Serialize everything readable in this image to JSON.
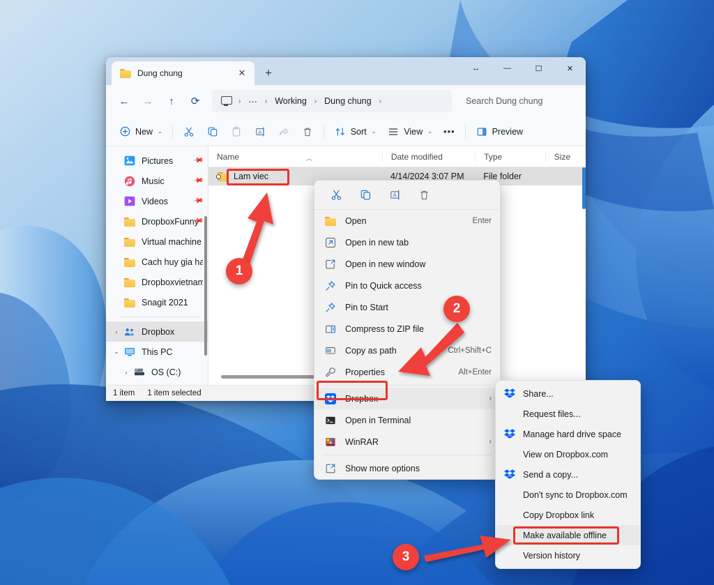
{
  "window": {
    "tab_title": "Dung chung",
    "tab_close_glyph": "✕",
    "newtab_glyph": "+",
    "minimize_glyph": "—",
    "maximize_glyph": "☐",
    "close_glyph": "✕",
    "snap_glyph": "↔"
  },
  "nav": {
    "back_glyph": "←",
    "forward_glyph": "→",
    "up_glyph": "↑",
    "refresh_glyph": "⟳",
    "breadcrumb": [
      "⋯",
      "Working",
      "Dung chung"
    ],
    "separator_glyph": "›"
  },
  "search": {
    "placeholder": "Search Dung chung"
  },
  "toolbar": {
    "new_label": "New",
    "cut_label": "Cut",
    "copy_label": "Copy",
    "paste_label": "Paste",
    "rename_label": "Rename",
    "share_label": "Share",
    "delete_label": "Delete",
    "sort_label": "Sort",
    "view_label": "View",
    "more_glyph": "•••",
    "preview_label": "Preview"
  },
  "sidebar": {
    "items": [
      {
        "label": "Pictures",
        "icon": "pictures-icon",
        "pinned": true,
        "chev": "",
        "selected": false
      },
      {
        "label": "Music",
        "icon": "music-icon",
        "pinned": true,
        "chev": "",
        "selected": false
      },
      {
        "label": "Videos",
        "icon": "videos-icon",
        "pinned": true,
        "chev": "",
        "selected": false
      },
      {
        "label": "DropboxFunny",
        "icon": "folder-icon",
        "pinned": true,
        "chev": "",
        "selected": false
      },
      {
        "label": "Virtual machine",
        "icon": "folder-icon",
        "pinned": false,
        "chev": "",
        "selected": false
      },
      {
        "label": "Cach huy gia han drc",
        "icon": "folder-icon",
        "pinned": false,
        "chev": "",
        "selected": false
      },
      {
        "label": "Dropboxvietnam me",
        "icon": "folder-icon",
        "pinned": false,
        "chev": "",
        "selected": false
      },
      {
        "label": "Snagit 2021",
        "icon": "folder-icon",
        "pinned": false,
        "chev": "",
        "selected": false
      }
    ],
    "tree": [
      {
        "label": "Dropbox",
        "icon": "dropbox-people-icon",
        "chev": "›",
        "selected": true
      },
      {
        "label": "This PC",
        "icon": "this-pc-icon",
        "chev": "⌄",
        "selected": false
      },
      {
        "label": "OS (C:)",
        "icon": "drive-icon",
        "chev": "›",
        "selected": false
      }
    ]
  },
  "filelist": {
    "columns": [
      "Name",
      "Date modified",
      "Type",
      "Size"
    ],
    "rows": [
      {
        "name": "Lam viec",
        "date_modified": "4/14/2024 3:07 PM",
        "type": "File folder",
        "size": ""
      }
    ]
  },
  "statusbar": {
    "count": "1 item",
    "selected": "1 item selected"
  },
  "context_menu": {
    "icon_row": [
      {
        "name": "cut-icon",
        "label": "Cut"
      },
      {
        "name": "copy-icon",
        "label": "Copy"
      },
      {
        "name": "rename-icon",
        "label": "Rename"
      },
      {
        "name": "delete-icon",
        "label": "Delete"
      }
    ],
    "items": [
      {
        "label": "Open",
        "shortcut": "Enter",
        "icon": "folder-icon",
        "submenu": false,
        "highlight": false
      },
      {
        "label": "Open in new tab",
        "shortcut": "",
        "icon": "new-tab-icon",
        "submenu": false,
        "highlight": false
      },
      {
        "label": "Open in new window",
        "shortcut": "",
        "icon": "new-window-icon",
        "submenu": false,
        "highlight": false
      },
      {
        "label": "Pin to Quick access",
        "shortcut": "",
        "icon": "pin-icon",
        "submenu": false,
        "highlight": false
      },
      {
        "label": "Pin to Start",
        "shortcut": "",
        "icon": "pin-icon",
        "submenu": false,
        "highlight": false
      },
      {
        "label": "Compress to ZIP file",
        "shortcut": "",
        "icon": "zip-icon",
        "submenu": false,
        "highlight": false
      },
      {
        "label": "Copy as path",
        "shortcut": "Ctrl+Shift+C",
        "icon": "copy-path-icon",
        "submenu": false,
        "highlight": false
      },
      {
        "label": "Properties",
        "shortcut": "Alt+Enter",
        "icon": "wrench-icon",
        "submenu": false,
        "highlight": false
      },
      {
        "label": "Dropbox",
        "shortcut": "",
        "icon": "dropbox-icon",
        "submenu": true,
        "highlight": true
      },
      {
        "label": "Open in Terminal",
        "shortcut": "",
        "icon": "terminal-icon",
        "submenu": false,
        "highlight": false
      },
      {
        "label": "WinRAR",
        "shortcut": "",
        "icon": "winrar-icon",
        "submenu": true,
        "highlight": false
      },
      {
        "label": "Show more options",
        "shortcut": "",
        "icon": "more-options-icon",
        "submenu": false,
        "highlight": false
      }
    ],
    "submenu_glyph": "›"
  },
  "dropbox_submenu": {
    "items": [
      {
        "label": "Share...",
        "icon": "dropbox-glyph-icon",
        "highlight": false
      },
      {
        "label": "Request files...",
        "icon": "",
        "highlight": false
      },
      {
        "label": "Manage hard drive space",
        "icon": "dropbox-glyph-icon",
        "highlight": false
      },
      {
        "label": "View on Dropbox.com",
        "icon": "",
        "highlight": false
      },
      {
        "label": "Send a copy...",
        "icon": "dropbox-glyph-icon",
        "highlight": false
      },
      {
        "label": "Don't sync to Dropbox.com",
        "icon": "",
        "highlight": false
      },
      {
        "label": "Copy Dropbox link",
        "icon": "",
        "highlight": false
      },
      {
        "label": "Make available offline",
        "icon": "",
        "highlight": true
      },
      {
        "label": "Version history",
        "icon": "",
        "highlight": false
      }
    ]
  },
  "annotations": {
    "accent_color": "#f0413a",
    "steps": [
      {
        "number": "1",
        "target": "Lam viec folder"
      },
      {
        "number": "2",
        "target": "Dropbox context menu item"
      },
      {
        "number": "3",
        "target": "Make available offline"
      }
    ]
  }
}
